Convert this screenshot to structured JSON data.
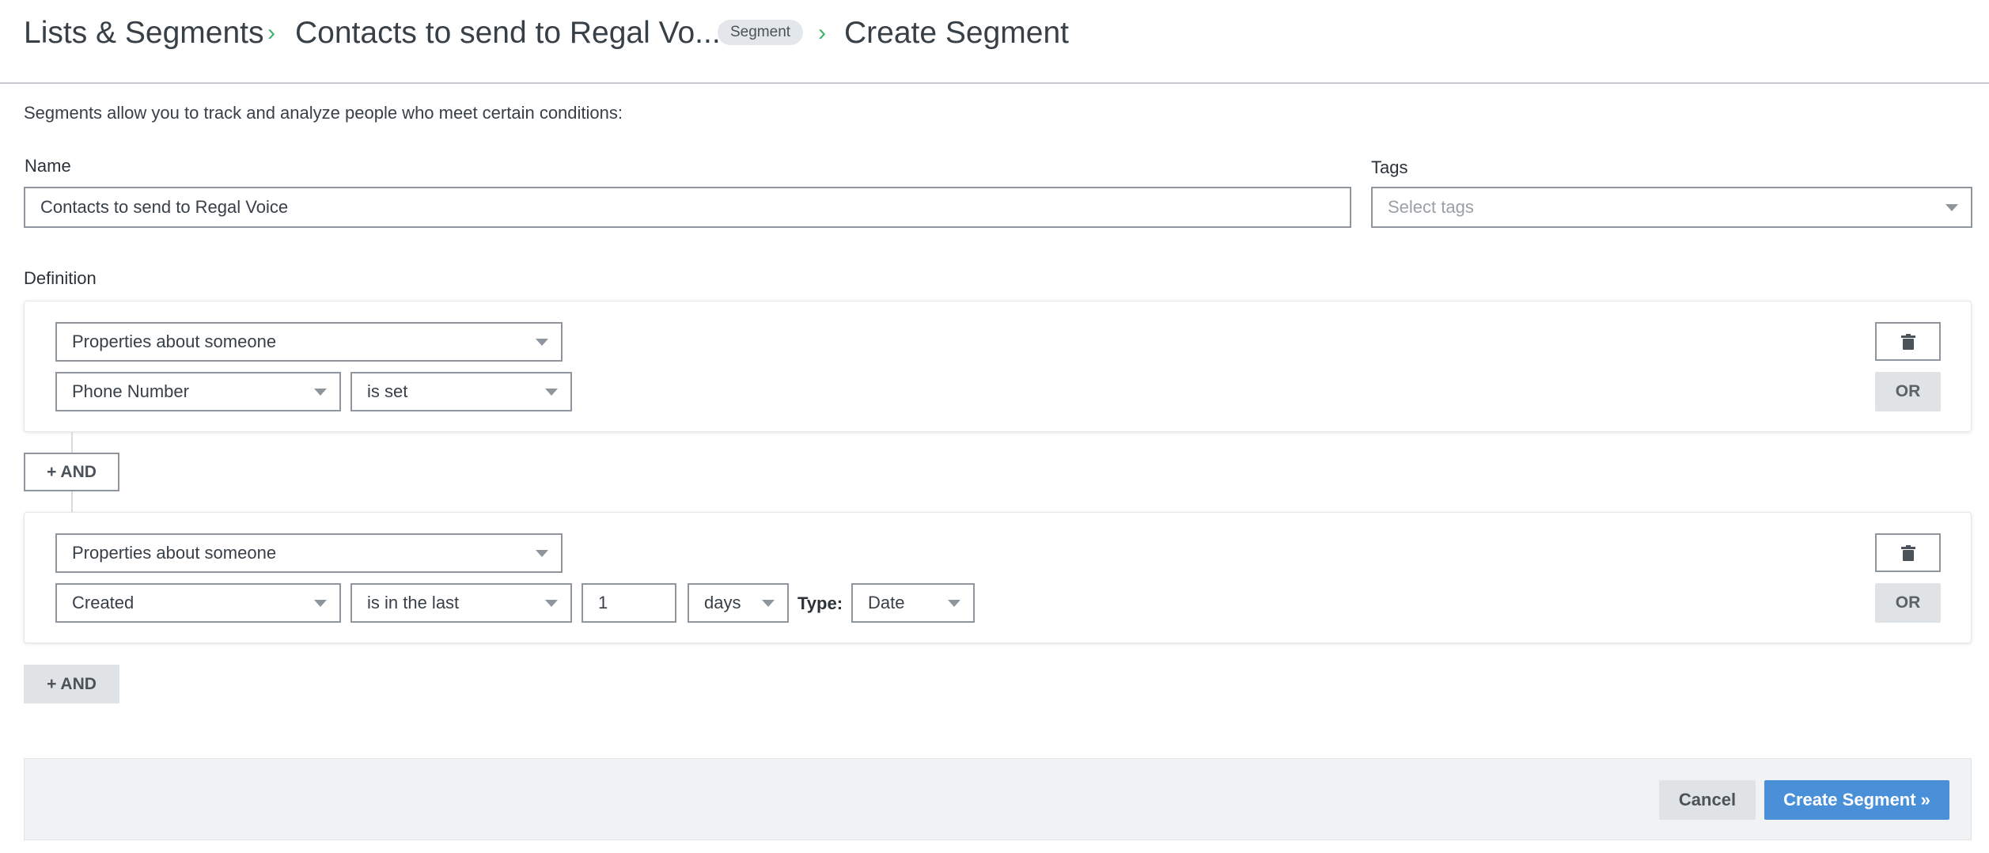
{
  "breadcrumb": {
    "root": "Lists & Segments",
    "list_name": "Contacts to send to Regal Vo...",
    "badge": "Segment",
    "current": "Create Segment",
    "separator": "›"
  },
  "intro": "Segments allow you to track and analyze people who meet certain conditions:",
  "name_field": {
    "label": "Name",
    "value": "Contacts to send to Regal Voice"
  },
  "tags_field": {
    "label": "Tags",
    "placeholder": "Select tags"
  },
  "definition": {
    "label": "Definition",
    "conditions": [
      {
        "type": "Properties about someone",
        "property": "Phone Number",
        "operator": "is set"
      },
      {
        "type": "Properties about someone",
        "property": "Created",
        "operator": "is in the last",
        "value": "1",
        "unit": "days",
        "value_type_label": "Type:",
        "value_type": "Date"
      }
    ],
    "or_label": "OR",
    "and_label": "+ AND"
  },
  "footer": {
    "cancel": "Cancel",
    "submit": "Create Segment »"
  },
  "icons": {
    "delete": "trash-icon",
    "dropdown": "caret-down-icon",
    "separator": "chevron-right-icon"
  },
  "colors": {
    "accent": "#4a90d9",
    "separator": "#3cb371"
  }
}
